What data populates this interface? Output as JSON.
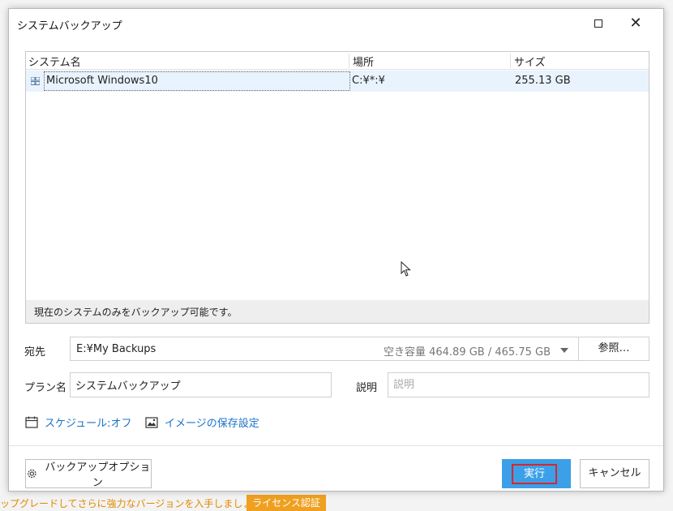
{
  "dialog": {
    "title": "システムバックアップ"
  },
  "list": {
    "columns": [
      "システム名",
      "場所",
      "サイズ"
    ],
    "rows": [
      {
        "name": "Microsoft Windows10",
        "location": "C:¥*:¥",
        "size": "255.13 GB"
      }
    ],
    "footer": "現在のシステムのみをバックアップ可能です。"
  },
  "destination": {
    "label": "宛先",
    "path": "E:¥My Backups",
    "space": "空き容量 464.89 GB / 465.75 GB",
    "browse_label": "参照…"
  },
  "plan": {
    "label": "プラン名",
    "value": "システムバックアップ"
  },
  "description": {
    "label": "説明",
    "placeholder": "説明"
  },
  "links": {
    "schedule": "スケジュール:オフ",
    "image_settings": "イメージの保存設定"
  },
  "buttons": {
    "options": "バックアップオプション",
    "run": "実行",
    "cancel": "キャンセル"
  },
  "underlying": {
    "text": "ップグレードしてさらに強力なバージョンを入手しましょう。",
    "button": "ライセンス認証"
  },
  "colors": {
    "accent": "#3ba0e8",
    "link": "#1a73c8",
    "highlight": "#d9262e",
    "warning": "#f0a020"
  }
}
